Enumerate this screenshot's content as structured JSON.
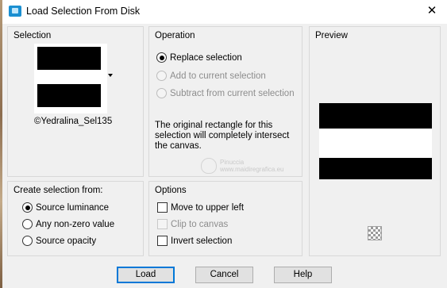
{
  "window": {
    "title": "Load Selection From Disk",
    "close_glyph": "✕",
    "icon": "selection-dialog-icon"
  },
  "selection_group": {
    "label": "Selection",
    "selected_file": "©Yedralina_Sel135"
  },
  "operation_group": {
    "label": "Operation",
    "options": [
      {
        "label": "Replace selection",
        "checked": true,
        "enabled": true
      },
      {
        "label": "Add to current selection",
        "checked": false,
        "enabled": false
      },
      {
        "label": "Subtract from current selection",
        "checked": false,
        "enabled": false
      }
    ],
    "description": "The original rectangle for this selection will completely intersect the canvas."
  },
  "preview_group": {
    "label": "Preview"
  },
  "create_from_group": {
    "label": "Create selection from:",
    "options": [
      {
        "label": "Source luminance",
        "checked": true
      },
      {
        "label": "Any non-zero value",
        "checked": false
      },
      {
        "label": "Source opacity",
        "checked": false
      }
    ]
  },
  "options_group": {
    "label": "Options",
    "checkboxes": [
      {
        "label": "Move to upper left",
        "checked": false,
        "enabled": true
      },
      {
        "label": "Clip to canvas",
        "checked": false,
        "enabled": false
      },
      {
        "label": "Invert selection",
        "checked": false,
        "enabled": true
      }
    ]
  },
  "watermark": {
    "line1": "Pinuccia",
    "line2": "www.maidiregrafica.eu"
  },
  "buttons": {
    "load": "Load",
    "cancel": "Cancel",
    "help": "Help"
  },
  "colors": {
    "window_bg": "#f0f0f0",
    "default_button_border": "#0078d7",
    "disabled_text": "#8d8d8d"
  }
}
